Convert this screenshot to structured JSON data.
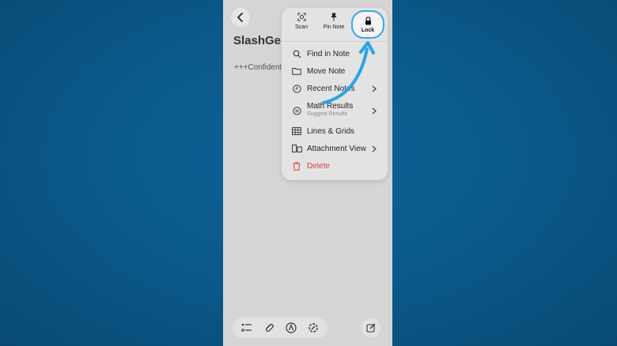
{
  "note": {
    "title": "SlashGe",
    "body": "+++Confidentic"
  },
  "menu": {
    "actions": {
      "scan_label": "Scan",
      "pin_label": "Pin Note",
      "lock_label": "Lock"
    },
    "items": [
      {
        "label": "Find in Note",
        "icon": "magnifier-icon"
      },
      {
        "label": "Move Note",
        "icon": "folder-icon"
      },
      {
        "label": "Recent Notes",
        "icon": "clock-icon",
        "chevron": true
      },
      {
        "label": "Math Results",
        "sublabel": "Suggest Results",
        "icon": "equals-circle-icon",
        "chevron": true
      },
      {
        "label": "Lines & Grids",
        "icon": "grid-icon"
      },
      {
        "label": "Attachment View",
        "icon": "attachment-view-icon",
        "chevron": true
      },
      {
        "label": "Delete",
        "icon": "trash-icon"
      }
    ]
  },
  "colors": {
    "background": "#0b5788",
    "highlight": "#3aa7e3",
    "delete": "#d9413f"
  }
}
